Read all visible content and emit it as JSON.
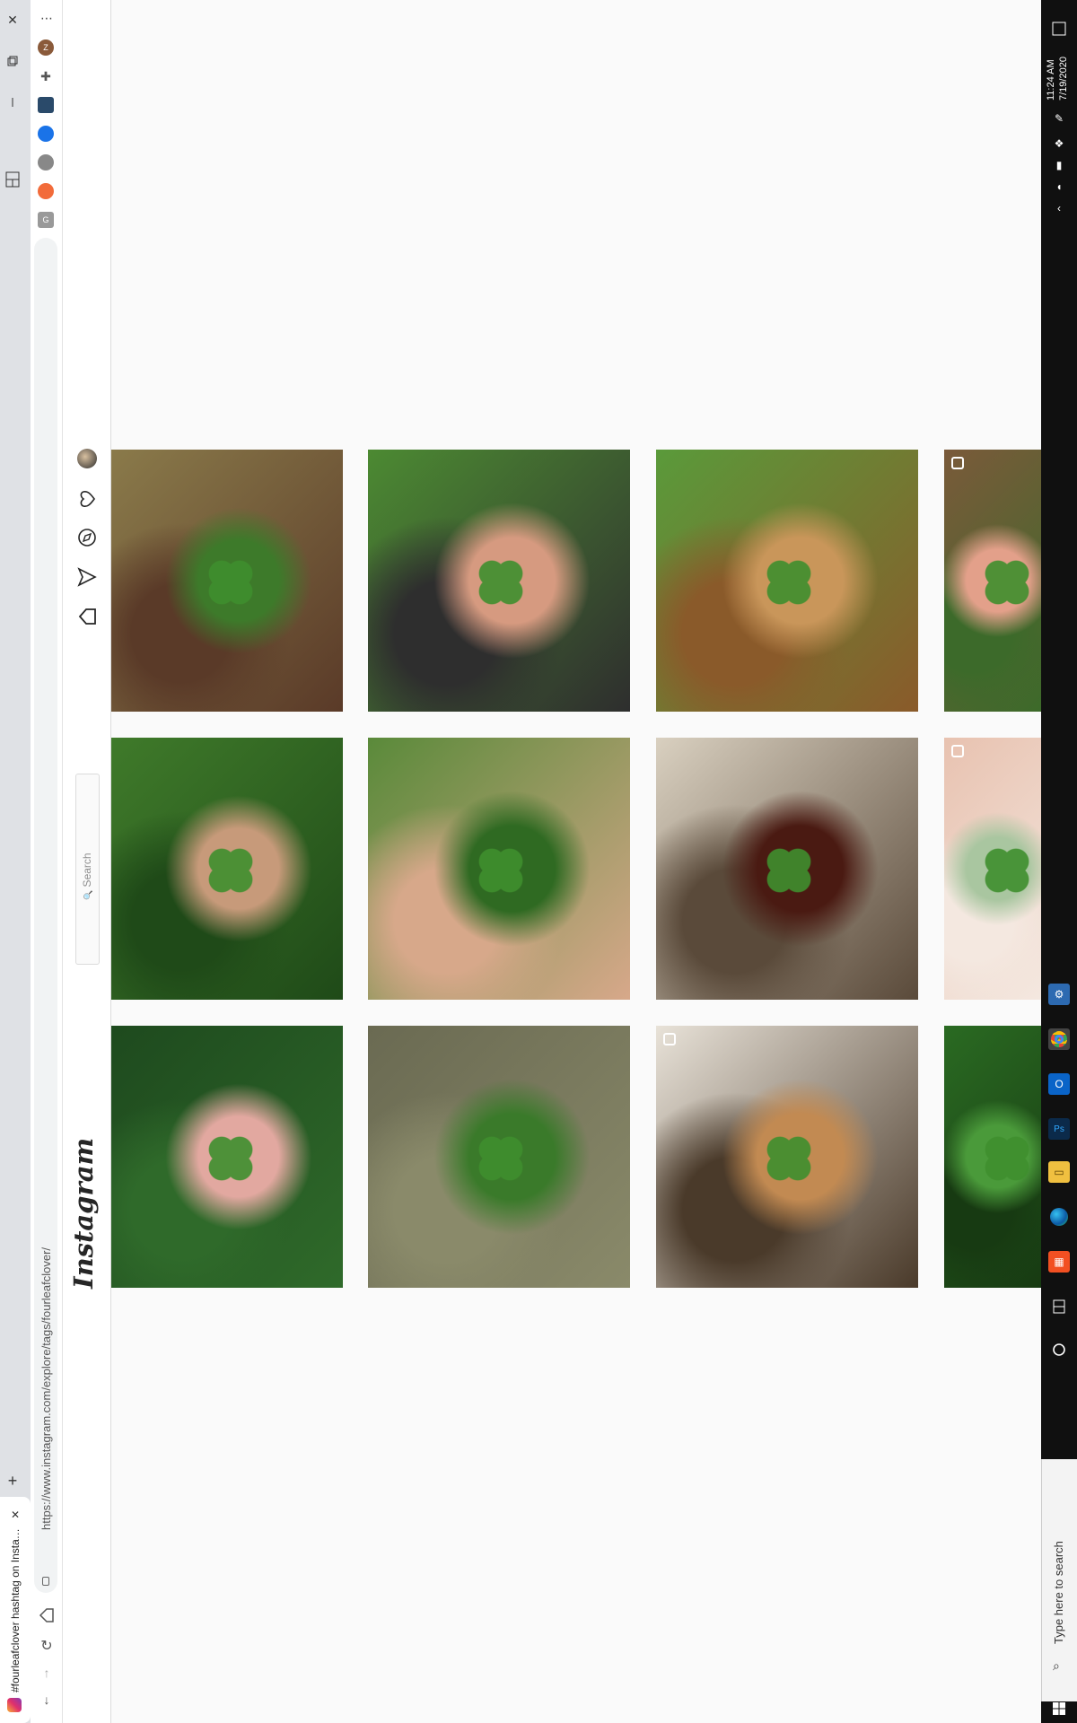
{
  "browser": {
    "tab_title": "#fourleafclover hashtag on Insta…",
    "url": "https://www.instagram.com/explore/tags/fourleafclover/",
    "close_glyph": "✕",
    "new_tab_glyph": "+",
    "more_glyph": "⋯"
  },
  "instagram": {
    "logo": "Instagram",
    "search_placeholder": "Search",
    "search_icon": "🔍"
  },
  "taskbar": {
    "time": "11:24 AM",
    "date": "7/19/2020",
    "search_placeholder": "Type here to search"
  },
  "grid": {
    "posts": [
      {
        "id": "p1",
        "multi": false,
        "palette": [
          "#8a7a4a",
          "#3d7a2a",
          "#5a3a28"
        ]
      },
      {
        "id": "p2",
        "multi": false,
        "palette": [
          "#4c8a32",
          "#d69a80",
          "#2e2e2e"
        ]
      },
      {
        "id": "p3",
        "multi": false,
        "palette": [
          "#5a9a3a",
          "#c9965a",
          "#8a5a2a"
        ]
      },
      {
        "id": "p4",
        "multi": true,
        "palette": [
          "#7a5a3a",
          "#e3a08a",
          "#3c6a2a"
        ]
      },
      {
        "id": "p5",
        "multi": false,
        "palette": [
          "#3f7a2a",
          "#c79a7a",
          "#1f4a18"
        ]
      },
      {
        "id": "p6",
        "multi": false,
        "palette": [
          "#5a8a3a",
          "#2f6a22",
          "#d7a88a"
        ]
      },
      {
        "id": "p7",
        "multi": false,
        "palette": [
          "#d9d0c0",
          "#4a1a12",
          "#5a4a3a"
        ]
      },
      {
        "id": "p8",
        "multi": true,
        "palette": [
          "#e8c2b0",
          "#a9c6a0",
          "#f4e8e0"
        ]
      },
      {
        "id": "p9",
        "multi": false,
        "palette": [
          "#1e4a1e",
          "#e2a8a0",
          "#2f6a2a"
        ]
      },
      {
        "id": "p10",
        "multi": false,
        "palette": [
          "#6a6a52",
          "#3a7a2a",
          "#8a8a6a"
        ]
      },
      {
        "id": "p11",
        "multi": true,
        "palette": [
          "#e8e2d8",
          "#c28a52",
          "#4a3a2a"
        ]
      },
      {
        "id": "p12",
        "multi": false,
        "palette": [
          "#2a6a22",
          "#4a9a3a",
          "#173a12"
        ]
      }
    ]
  }
}
